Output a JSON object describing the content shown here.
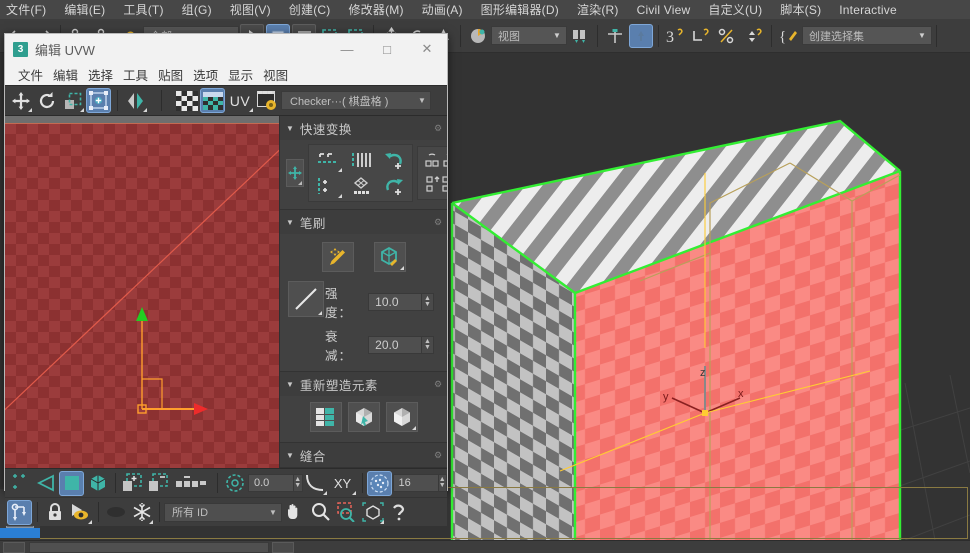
{
  "app": {
    "menubar": [
      {
        "label": "文件(F)"
      },
      {
        "label": "编辑(E)"
      },
      {
        "label": "工具(T)"
      },
      {
        "label": "组(G)"
      },
      {
        "label": "视图(V)"
      },
      {
        "label": "创建(C)"
      },
      {
        "label": "修改器(M)"
      },
      {
        "label": "动画(A)"
      },
      {
        "label": "图形编辑器(D)"
      },
      {
        "label": "渲染(R)"
      },
      {
        "label": "Civil View"
      },
      {
        "label": "自定义(U)"
      },
      {
        "label": "脚本(S)"
      },
      {
        "label": "Interactive"
      }
    ],
    "toolbar": {
      "ref_coord_value": "视图",
      "selection_set_placeholder": "创建选择集",
      "icons": [
        "undo-icon",
        "redo-icon",
        "select-link-icon",
        "unlink-icon",
        "bind-space-warp-icon",
        "selection-filter-combo",
        "select-object-icon",
        "select-by-name-icon",
        "rect-select-region-icon",
        "window-crossing-icon",
        "select-move-icon",
        "select-rotate-icon",
        "select-scale-icon",
        "ref-coord-combo",
        "use-pivot-center-icon",
        "select-and-place-icon",
        "snap-toggle-icon",
        "angle-snap-icon",
        "percent-snap-icon",
        "spinner-snap-icon",
        "named-selection-sets-icon"
      ]
    }
  },
  "dialog": {
    "title": "编辑 UVW",
    "app_icon_text": "3",
    "window_buttons": {
      "minimize": "—",
      "maximize": "□",
      "close": "✕"
    },
    "menu": [
      {
        "label": "文件"
      },
      {
        "label": "编辑"
      },
      {
        "label": "选择"
      },
      {
        "label": "工具"
      },
      {
        "label": "贴图"
      },
      {
        "label": "选项"
      },
      {
        "label": "显示"
      },
      {
        "label": "视图"
      }
    ],
    "toolbar": {
      "icons": [
        "move-icon",
        "rotate-icon",
        "scale-icon",
        "freeform-mode-icon",
        "mirror-icon",
        "show-map-icon",
        "uv-checker-icon",
        "uv-label",
        "map-options-icon"
      ],
      "uv_label": "UV",
      "map_combo_value": "Checker···( 棋盘格 )",
      "map_combo_arrow": "▼"
    },
    "rollouts": [
      {
        "id": "quick-transform",
        "title": "快速变换",
        "expanded": true,
        "icons": [
          "align-to-edge-icon",
          "space-horizontal-icon",
          "space-vertical-icon",
          "rotate-ccw-icon",
          "align-vertical-icon",
          "align-horizontal-icon",
          "relax-icon",
          "straighten-icon",
          "rotate-cw-icon",
          "flip-horizontal-icon",
          "flip-vertical-icon"
        ]
      },
      {
        "id": "brush",
        "title": "笔刷",
        "expanded": true,
        "icons": [
          "paint-move-brush-icon",
          "paint-relax-brush-icon",
          "falloff-curve-icon"
        ],
        "fields": [
          {
            "label": "强度：",
            "value": "10.0"
          },
          {
            "label": "衰减：",
            "value": "20.0"
          }
        ]
      },
      {
        "id": "reshape-elements",
        "title": "重新塑造元素",
        "expanded": true,
        "icons": [
          "peel-mode-icon",
          "quick-peel-icon",
          "pelt-map-icon"
        ]
      },
      {
        "id": "stitch",
        "title": "缝合",
        "expanded": true,
        "icons": []
      }
    ],
    "bottom_bar_row1": {
      "icons": [
        "vertex-subobject-icon",
        "edge-subobject-icon",
        "face-subobject-icon",
        "element-subobject-icon",
        "filter-selected-faces-icon",
        "select-element-icon",
        "select-by-id-icon",
        "soft-selection-icon"
      ],
      "angle_value": "0.0",
      "axis_label": "XY",
      "grid_value": "16",
      "arrow_up": "▲",
      "arrow_down": "▼"
    },
    "bottom_bar_row2": {
      "icons": [
        "move-to-target-icon",
        "lock-selection-icon",
        "filter-by-view-icon",
        "hide-icon",
        "freeze-icon",
        "pan-icon",
        "zoom-icon",
        "zoom-region-icon",
        "zoom-extents-icon",
        "help-icon"
      ],
      "material_id_combo_value": "所有 ID",
      "material_id_arrow": "▼"
    },
    "uv_canvas": {
      "name": "uv-edit-canvas",
      "checker_light": "#9b3c3c",
      "checker_dark": "#8c3131",
      "gizmo_color": "#ff9e2c",
      "gizmo_x_color": "#ee2b2b",
      "gizmo_y_color": "#22cc22",
      "seam_line_color": "#e05a4a"
    }
  },
  "viewport": {
    "name": "perspective-viewport",
    "background": "#333333",
    "cube": {
      "top_face_light": "#ededed",
      "top_face_dark": "#8e8e8e",
      "front_face_light": "#fa8a84",
      "front_face_dark": "#f4746e",
      "side_face_light": "#b9b9b9",
      "side_face_dark": "#6f6f6f",
      "selection_edge_color": "#33ee33",
      "bracket_color": "#b8a05a"
    },
    "gizmo": {
      "x_label": "x",
      "y_label": "y",
      "z_label": "z",
      "axis_color": "#ffcc33"
    },
    "axis_tripod": {
      "x_label": "x",
      "y_label": "y",
      "z_label": "z",
      "x_color": "#cc3333",
      "y_color": "#33aa33",
      "z_color": "#3344cc"
    }
  }
}
